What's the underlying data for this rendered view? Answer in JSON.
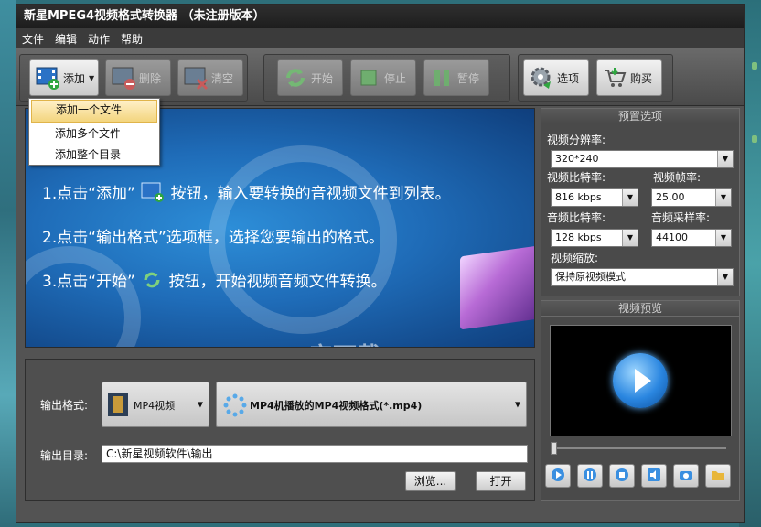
{
  "window": {
    "title": "新星MPEG4视频格式转换器 （未注册版本）"
  },
  "menu": [
    "文件",
    "编辑",
    "动作",
    "帮助"
  ],
  "toolbar": {
    "add": "添加",
    "delete": "删除",
    "clear": "清空",
    "start": "开始",
    "stop": "停止",
    "pause": "暂停",
    "options": "选项",
    "buy": "购买"
  },
  "add_menu": [
    "添加一个文件",
    "添加多个文件",
    "添加整个目录"
  ],
  "banner": {
    "step1": "1.点击“添加”",
    "step1_tail": "按钮，输入要转换的音视频文件到列表。",
    "step2": "2.点击“输出格式”选项框，选择您要输出的格式。",
    "step3": "3.点击“开始”",
    "step3_tail": "按钮，开始视频音频文件转换。",
    "watermark": "安下载 anxz.com"
  },
  "output": {
    "format_label": "输出格式:",
    "format_value": "MP4视频",
    "profile_value": "MP4机播放的MP4视频格式(*.mp4)",
    "dir_label": "输出目录:",
    "dir_value": "C:\\新星视频软件\\输出",
    "browse": "浏览...",
    "open": "打开"
  },
  "preset": {
    "title": "预置选项",
    "resolution_label": "视频分辨率:",
    "resolution": "320*240",
    "vbitrate_label": "视频比特率:",
    "vbitrate": "816 kbps",
    "fps_label": "视频帧率:",
    "fps": "25.00",
    "abitrate_label": "音频比特率:",
    "abitrate": "128 kbps",
    "samplerate_label": "音频采样率:",
    "samplerate": "44100",
    "scale_label": "视频缩放:",
    "scale": "保持原视频模式"
  },
  "preview": {
    "title": "视频预览"
  }
}
